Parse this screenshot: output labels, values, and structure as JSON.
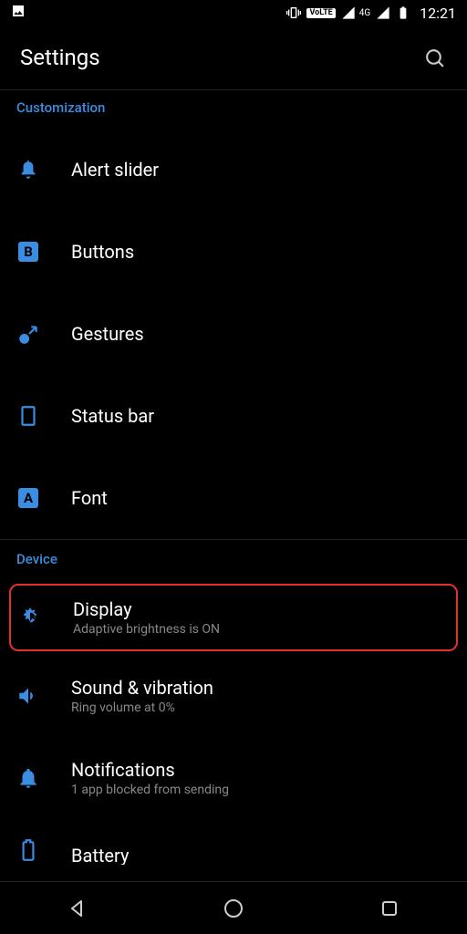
{
  "status": {
    "network_label": "4G",
    "volte": "VoLTE",
    "time": "12:21"
  },
  "header": {
    "title": "Settings"
  },
  "sections": {
    "customization": {
      "label": "Customization",
      "items": [
        {
          "title": "Alert slider"
        },
        {
          "title": "Buttons"
        },
        {
          "title": "Gestures"
        },
        {
          "title": "Status bar"
        },
        {
          "title": "Font"
        }
      ]
    },
    "device": {
      "label": "Device",
      "items": [
        {
          "title": "Display",
          "sub": "Adaptive brightness is ON"
        },
        {
          "title": "Sound & vibration",
          "sub": "Ring volume at 0%"
        },
        {
          "title": "Notifications",
          "sub": "1 app blocked from sending"
        },
        {
          "title": "Battery"
        }
      ]
    }
  },
  "icons": {
    "buttons_letter": "B",
    "font_letter": "A"
  }
}
